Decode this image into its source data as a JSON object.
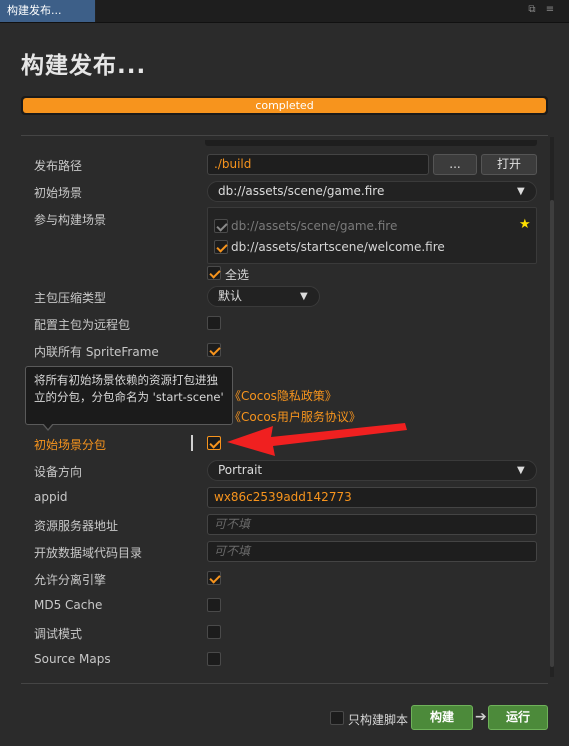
{
  "window": {
    "tab_title": "构建发布...",
    "page_title": "构建发布..."
  },
  "progress": {
    "label": "completed",
    "percent": 100,
    "color": "#f7941d"
  },
  "form": {
    "publish_path": {
      "label": "发布路径",
      "value": "./build",
      "browse_label": "...",
      "open_label": "打开"
    },
    "start_scene": {
      "label": "初始场景",
      "value": "db://assets/scene/game.fire"
    },
    "build_scenes": {
      "label": "参与构建场景",
      "items": [
        {
          "path": "db://assets/scene/game.fire",
          "checked": true,
          "disabled": true,
          "start": true
        },
        {
          "path": "db://assets/startscene/welcome.fire",
          "checked": true,
          "disabled": false,
          "start": false
        }
      ],
      "select_all_label": "全选"
    },
    "compression": {
      "label": "主包压缩类型",
      "value": "默认"
    },
    "remote_main": {
      "label": "配置主包为远程包",
      "checked": false
    },
    "inline_spriteframe": {
      "label": "内联所有 SpriteFrame",
      "checked": true
    },
    "privacy_link": "《Cocos隐私政策》",
    "terms_link": "《Cocos用户服务协议》",
    "start_scene_subpackage": {
      "label": "初始场景分包",
      "checked": true,
      "tooltip": "将所有初始场景依赖的资源打包进独立的分包，分包命名为 'start-scene'"
    },
    "orientation": {
      "label": "设备方向",
      "value": "Portrait"
    },
    "appid": {
      "label": "appid",
      "value": "wx86c2539add142773"
    },
    "resource_server": {
      "label": "资源服务器地址",
      "placeholder": "可不填"
    },
    "open_data_dir": {
      "label": "开放数据域代码目录",
      "placeholder": "可不填"
    },
    "separate_engine": {
      "label": "允许分离引擎",
      "checked": true
    },
    "md5_cache": {
      "label": "MD5 Cache",
      "checked": false
    },
    "debug_mode": {
      "label": "调试模式",
      "checked": false
    },
    "source_maps": {
      "label": "Source Maps",
      "checked": false
    }
  },
  "footer": {
    "only_script_label": "只构建脚本",
    "only_script_checked": false,
    "build_label": "构建",
    "run_label": "运行"
  },
  "colors": {
    "accent": "#f7941d",
    "annotation_arrow": "#f02020",
    "build_button": "#4c8a3a"
  },
  "icons": {
    "browse": "ellipsis-icon",
    "dropdown": "caret-down-icon",
    "start_marker": "star-icon",
    "panel_popout": "popout-icon",
    "panel_menu": "menu-icon",
    "build_run_link": "arrow-right-icon",
    "annotation": "red-arrow-icon"
  }
}
